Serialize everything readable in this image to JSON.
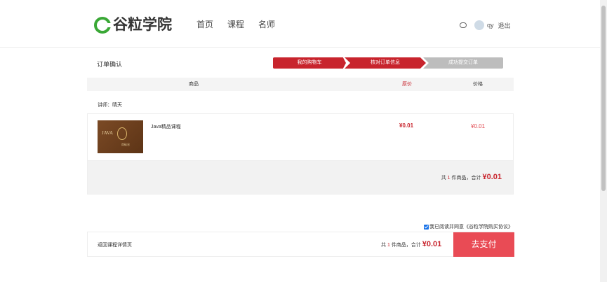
{
  "header": {
    "logo_text": "谷粒学院",
    "nav": [
      "首页",
      "课程",
      "名师"
    ],
    "username": "qy",
    "logout_label": "退出"
  },
  "order": {
    "page_title": "订单确认",
    "steps": [
      "我的购物车",
      "核对订单信息",
      "成功提交订单"
    ],
    "columns": {
      "goods": "商品",
      "original_price": "原价",
      "price": "价格"
    },
    "teacher_label": "讲师：晴天",
    "item": {
      "cover_text": "JAVA",
      "cover_caption": "尚硅谷",
      "name": "Java精品课程",
      "original_price": "¥0.01",
      "price": "¥0.01"
    },
    "summary": {
      "prefix": "共",
      "count": "1",
      "suffix": "件商品，合计",
      "total": "¥0.01"
    },
    "agreement": "我已阅读并同意《谷粒学院购买协议》",
    "back_label": "返回课程详情页",
    "pay_label": "去支付"
  },
  "colors": {
    "accent_red": "#c8242d",
    "pay_button": "#e94b55",
    "logo_green": "#3aa836"
  }
}
